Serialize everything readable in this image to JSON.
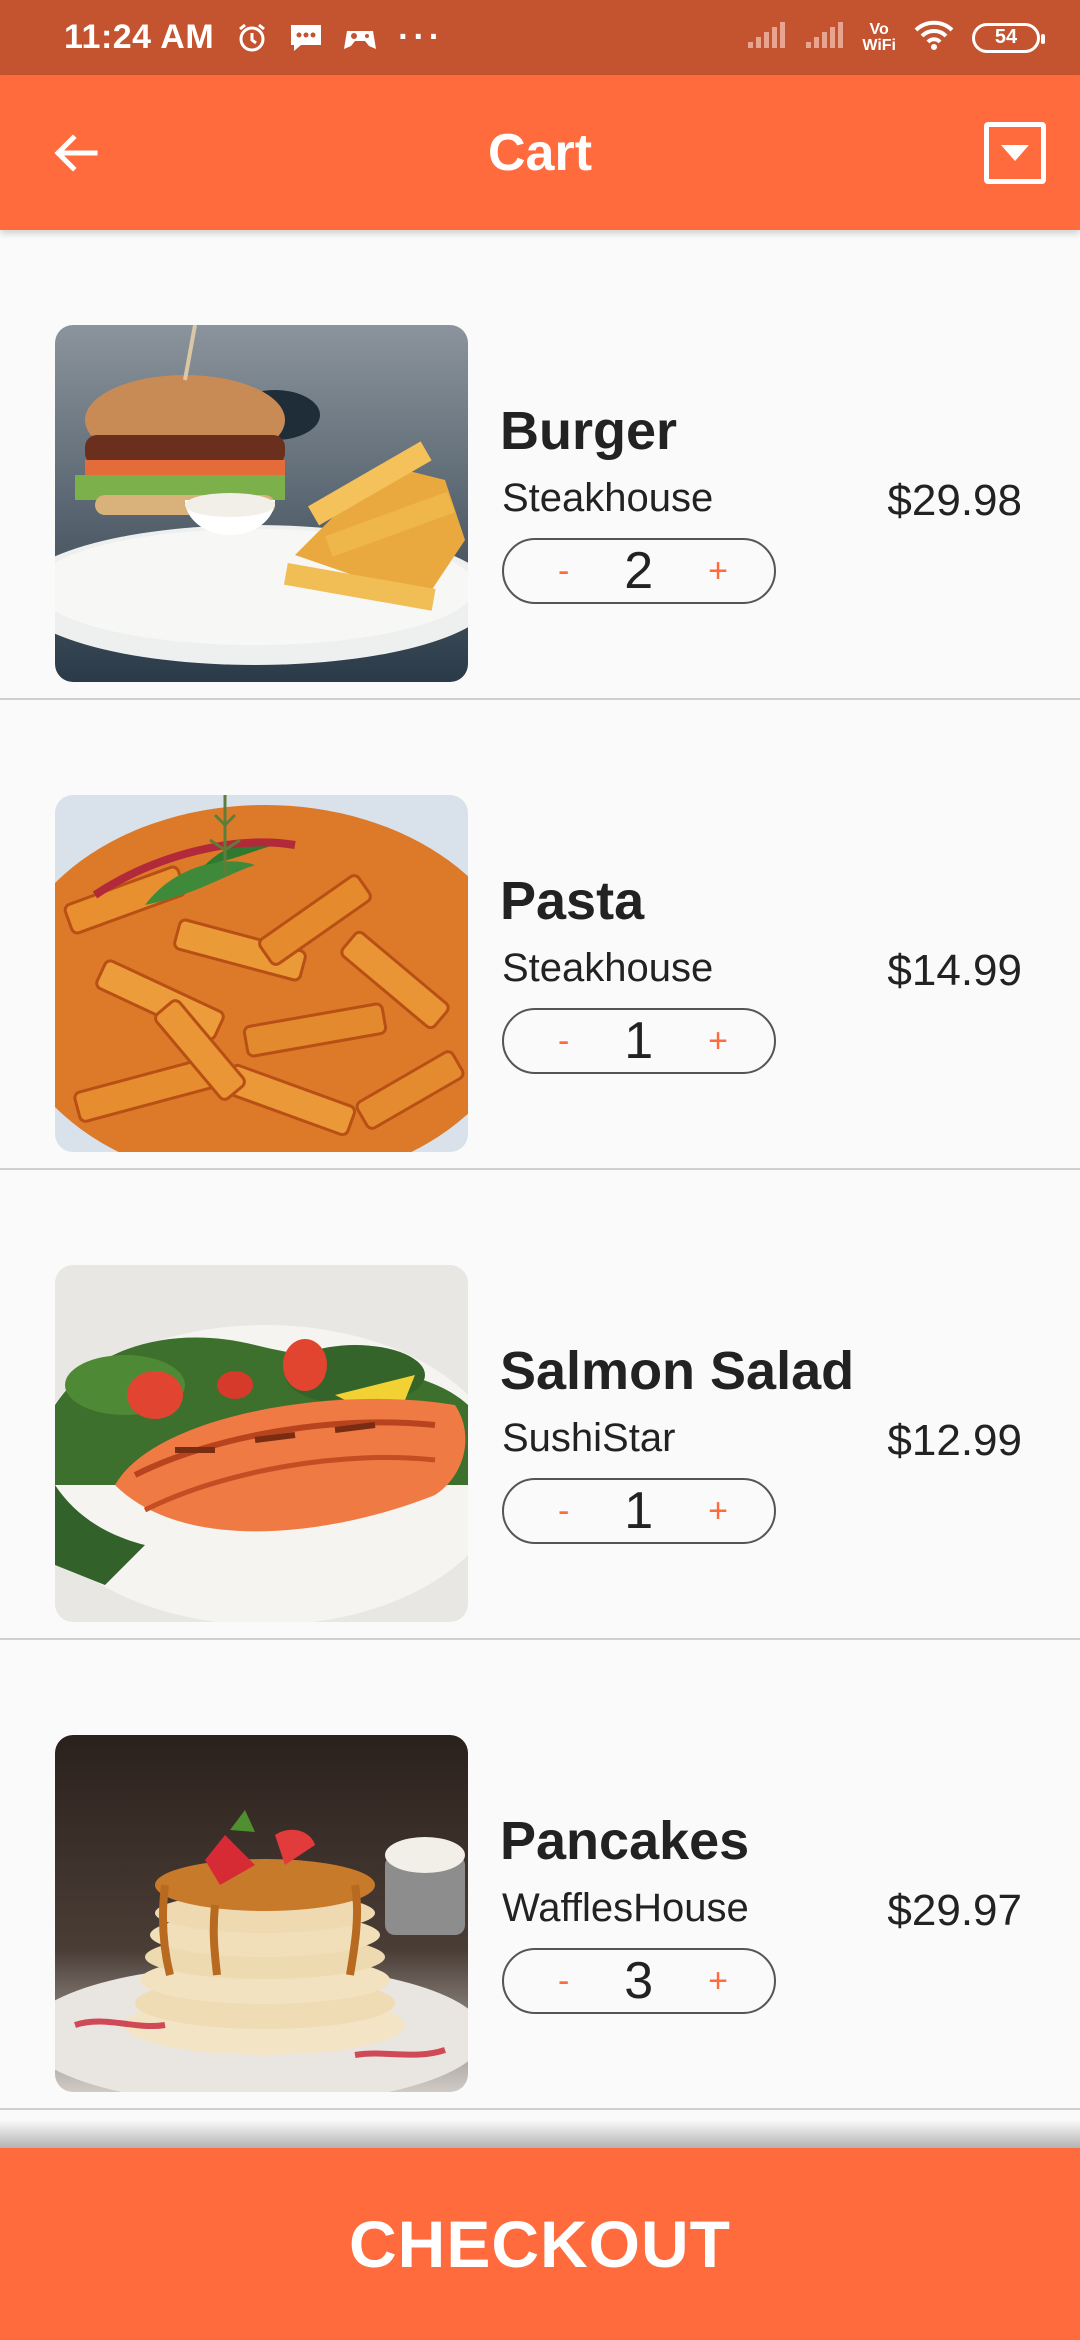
{
  "status_bar": {
    "time": "11:24 AM",
    "battery": "54",
    "vowifi_top": "Vo",
    "vowifi_bottom": "WiFi",
    "more_indicator": "···"
  },
  "app_bar": {
    "title": "Cart"
  },
  "cart": {
    "items": [
      {
        "name": "Burger",
        "restaurant": "Steakhouse",
        "price": "$29.98",
        "quantity": "2",
        "image": "burger-photo"
      },
      {
        "name": "Pasta",
        "restaurant": "Steakhouse",
        "price": "$14.99",
        "quantity": "1",
        "image": "pasta-photo"
      },
      {
        "name": "Salmon Salad",
        "restaurant": "SushiStar",
        "price": "$12.99",
        "quantity": "1",
        "image": "salmon-salad-photo"
      },
      {
        "name": "Pancakes",
        "restaurant": "WafflesHouse",
        "price": "$29.97",
        "quantity": "3",
        "image": "pancakes-photo"
      }
    ],
    "minus_label": "-",
    "plus_label": "+"
  },
  "checkout": {
    "label": "CHECKOUT"
  },
  "colors": {
    "primary": "#ff6b3d",
    "status_bar": "#c4532f",
    "background": "#fafafa",
    "text": "#222222"
  }
}
